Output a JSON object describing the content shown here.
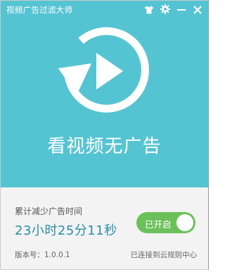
{
  "window": {
    "title": "视频广告过滤大师",
    "controls": [
      "tshirt-icon",
      "gear-icon",
      "minimize-icon",
      "close-icon"
    ]
  },
  "hero": {
    "slogan": "看视频无广告",
    "background_color": "#55c4d2",
    "icon": "refresh-play-icon"
  },
  "stats": {
    "label": "累计减少广告时间",
    "value": "23小时25分11秒"
  },
  "toggle": {
    "label": "已开启",
    "state": "on",
    "color": "#6cc05a"
  },
  "footer": {
    "version": "版本号：1.0.0.1",
    "cloud_status": "已连接到云规则中心"
  }
}
